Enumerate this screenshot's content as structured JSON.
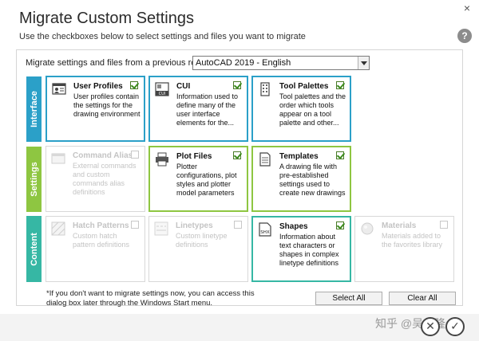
{
  "dialog": {
    "title": "Migrate Custom Settings",
    "subtitle": "Use the checkboxes below to select settings and files you want to migrate",
    "close_glyph": "×",
    "help_glyph": "?"
  },
  "release": {
    "label": "Migrate settings and files from a previous release:",
    "selected": "AutoCAD 2019 - English"
  },
  "sections": {
    "interface": "Interface",
    "settings": "Settings",
    "content": "Content"
  },
  "cards": {
    "user_profiles": {
      "name": "User Profiles",
      "desc": "User profiles contain the settings for the drawing environment",
      "checked": true,
      "icon": "user-profile-icon"
    },
    "cui": {
      "name": "CUI",
      "desc": "Information used to define many of the user interface elements for the...",
      "checked": true,
      "icon": "cui-icon",
      "icon_text": "CUI"
    },
    "tool_palettes": {
      "name": "Tool Palettes",
      "desc": "Tool palettes and the order which tools appear on a tool palette and other...",
      "checked": true,
      "icon": "tool-palette-icon"
    },
    "command_alias": {
      "name": "Command Alias",
      "desc": "External commands and custom commands alias definitions",
      "checked": false,
      "icon": "command-alias-icon"
    },
    "plot_files": {
      "name": "Plot Files",
      "desc": "Plotter configurations, plot styles and plotter model parameters",
      "checked": true,
      "icon": "printer-icon"
    },
    "templates": {
      "name": "Templates",
      "desc": "A drawing file with pre-established settings used to create new drawings",
      "checked": true,
      "icon": "template-icon"
    },
    "hatch_patterns": {
      "name": "Hatch Patterns",
      "desc": "Custom hatch pattern definitions",
      "checked": false,
      "icon": "hatch-pattern-icon"
    },
    "linetypes": {
      "name": "Linetypes",
      "desc": "Custom linetype definitions",
      "checked": false,
      "icon": "linetype-icon"
    },
    "shapes": {
      "name": "Shapes",
      "desc": "Information about text characters or shapes in complex linetype definitions",
      "checked": true,
      "icon": "shapes-icon",
      "icon_text": "SHX"
    },
    "materials": {
      "name": "Materials",
      "desc": "Materials added to the favorites library",
      "checked": false,
      "icon": "material-sphere-icon"
    }
  },
  "note": "*If you don't want to migrate settings now, you can access this dialog box later through the Windows Start menu.",
  "buttons": {
    "select_all": "Select All",
    "clear_all": "Clear All",
    "cancel_glyph": "✕",
    "ok_glyph": "✓"
  },
  "watermark": "知乎 @吴立隆",
  "colors": {
    "interface": "#2ba0c8",
    "settings": "#8ec641",
    "content": "#36b7a4",
    "check": "#3d8b1e"
  }
}
